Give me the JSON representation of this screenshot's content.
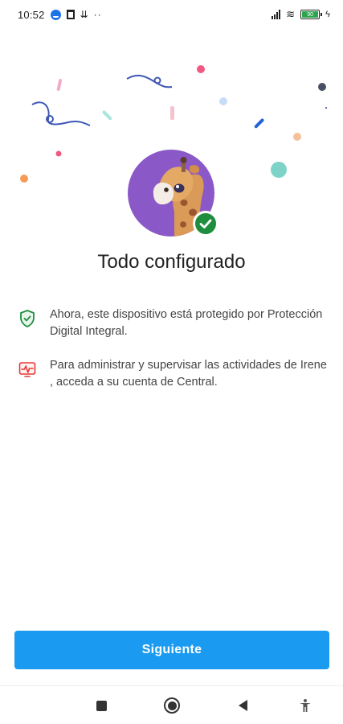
{
  "status_bar": {
    "time": "10:52",
    "battery_level": "90",
    "icons": [
      "messenger-icon",
      "trash-icon",
      "download-icon",
      "more-dots-icon",
      "signal-icon",
      "wifi-icon",
      "battery-icon",
      "charging-bolt-icon"
    ],
    "dots": "··",
    "download": "⇊",
    "wifi": "≋",
    "bolt": "ϟ"
  },
  "hero": {
    "avatar_icon": "giraffe-avatar-icon",
    "badge_icon": "check-badge-icon"
  },
  "setup": {
    "title": "Todo configurado",
    "protected_text": "Ahora, este dispositivo está protegido por Protección Digital Integral.",
    "manage_text": "Para administrar y supervisar las actividades de Irene , acceda a su cuenta de Central."
  },
  "actions": {
    "next_label": "Siguiente"
  },
  "navigation": {
    "buttons": [
      "recents",
      "home",
      "back",
      "accessibility"
    ]
  },
  "colors": {
    "accent": "#1a9af0",
    "success": "#1e8e3e",
    "avatar_bg": "#8a58c7",
    "alert": "#e53935"
  }
}
